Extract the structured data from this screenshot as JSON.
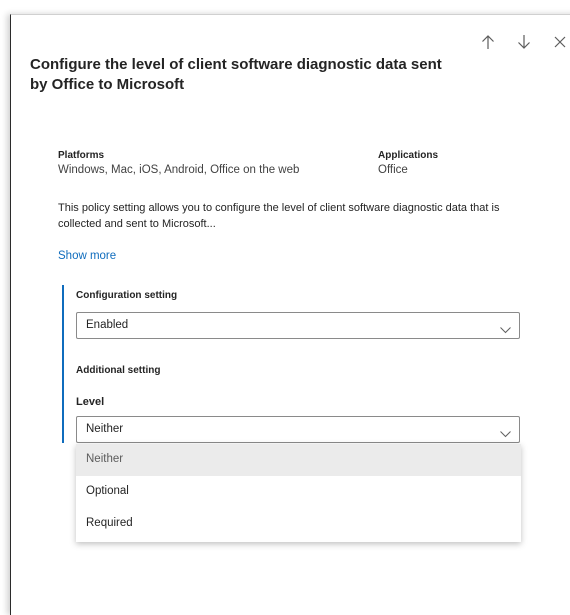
{
  "panel": {
    "title": "Configure the level of client software diagnostic data sent by Office to Microsoft",
    "nav": {
      "up_icon": "arrow-up-icon",
      "down_icon": "arrow-down-icon",
      "close_icon": "close-icon"
    }
  },
  "meta": {
    "platforms_label": "Platforms",
    "platforms_value": "Windows, Mac, iOS, Android, Office on the web",
    "applications_label": "Applications",
    "applications_value": "Office"
  },
  "description": "This policy setting allows you to configure the level of client software diagnostic data that is collected and sent to Microsoft...",
  "show_more": "Show more",
  "configuration": {
    "label": "Configuration setting",
    "value": "Enabled"
  },
  "additional": {
    "label": "Additional setting",
    "level_label": "Level",
    "level_value": "Neither",
    "options": [
      "Neither",
      "Optional",
      "Required"
    ]
  },
  "colors": {
    "accent": "#0f6cbd",
    "selected_bg": "#ebebeb"
  }
}
